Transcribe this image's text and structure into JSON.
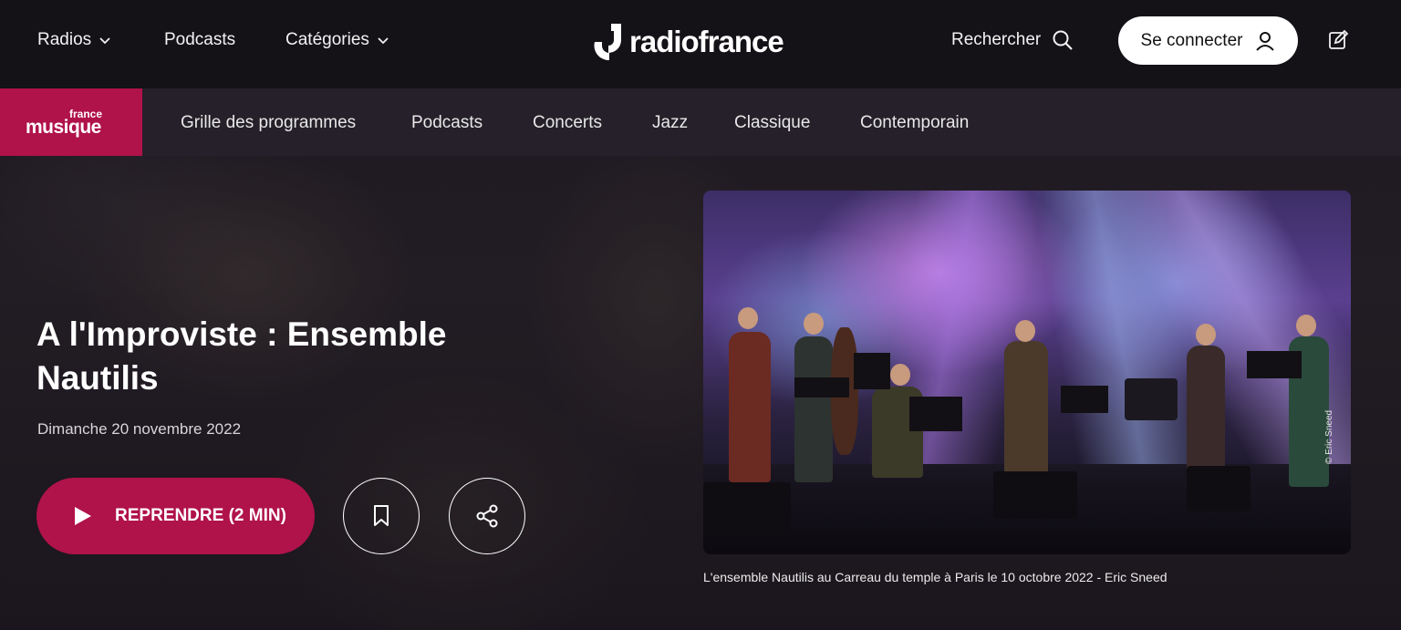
{
  "topbar": {
    "nav": [
      {
        "label": "Radios",
        "has_dropdown": true
      },
      {
        "label": "Podcasts",
        "has_dropdown": false
      },
      {
        "label": "Catégories",
        "has_dropdown": true
      }
    ],
    "logo_text": "radiofrance",
    "search_label": "Rechercher",
    "login_label": "Se connecter",
    "icons": {
      "search": "search-icon",
      "user": "user-icon",
      "edit": "edit-icon",
      "chevron": "chevron-down-icon"
    }
  },
  "station": {
    "logo_top": "france",
    "logo_bottom": "musique",
    "color": "#b0124a",
    "nav": [
      "Grille des programmes",
      "Podcasts",
      "Concerts",
      "Jazz",
      "Classique",
      "Contemporain"
    ]
  },
  "episode": {
    "title": "A l'Improviste : Ensemble Nautilis",
    "date": "Dimanche 20 novembre 2022",
    "resume_label": "REPRENDRE (2 MIN)",
    "icons": {
      "play": "play-icon",
      "bookmark": "bookmark-icon",
      "share": "share-icon"
    }
  },
  "photo": {
    "credit": "© Eric Sneed",
    "caption": "L'ensemble Nautilis au Carreau du temple à Paris le 10 octobre 2022 - Eric Sneed"
  }
}
